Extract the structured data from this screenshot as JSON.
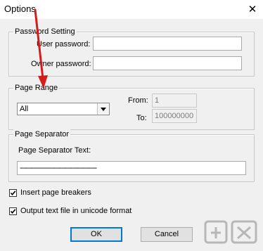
{
  "window": {
    "title": "Options",
    "close_glyph": "✕"
  },
  "password_group": {
    "legend": "Password Setting",
    "user_password_label": "User password:",
    "user_password_value": "",
    "owner_password_label": "Owner password:",
    "owner_password_value": ""
  },
  "page_range": {
    "legend": "Page Range",
    "selected": "All",
    "from_label": "From:",
    "from_value": "1",
    "to_label": "To:",
    "to_value": "100000000"
  },
  "separator": {
    "legend": "Page Separator",
    "text_label": "Page Separator Text:",
    "text_value": "-----------------------------------------"
  },
  "options": {
    "insert_breakers_label": "Insert page breakers",
    "insert_breakers_checked": true,
    "unicode_label": "Output text file in unicode format",
    "unicode_checked": true
  },
  "buttons": {
    "ok": "OK",
    "cancel": "Cancel"
  },
  "colors": {
    "annotation_arrow": "#d31c1c",
    "focus": "#0078d7"
  }
}
